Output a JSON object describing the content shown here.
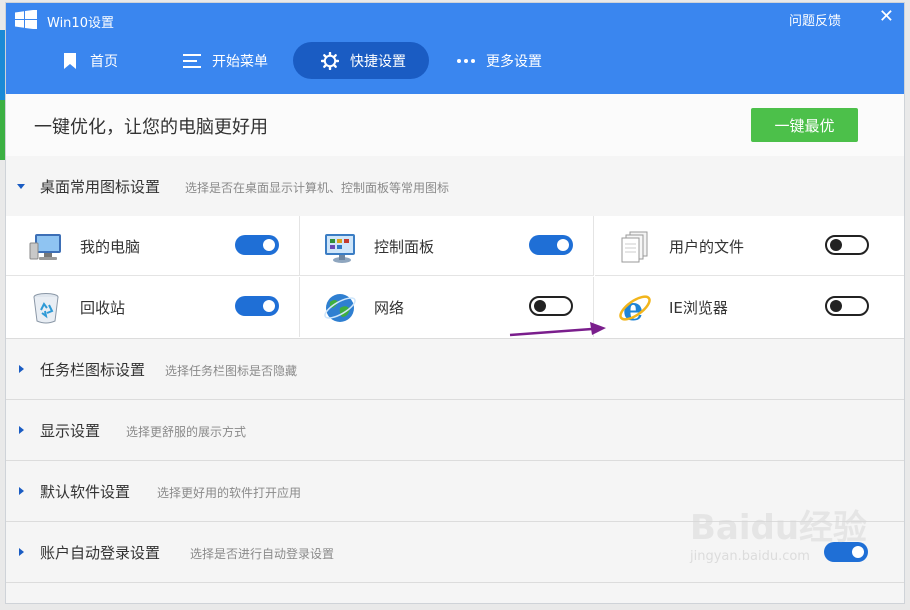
{
  "window": {
    "title": "Win10设置",
    "feedback": "问题反馈",
    "close": "✕"
  },
  "tabs": [
    {
      "label": "首页",
      "icon": "bookmark-icon"
    },
    {
      "label": "开始菜单",
      "icon": "menu-icon"
    },
    {
      "label": "快捷设置",
      "icon": "gear-icon",
      "active": true
    },
    {
      "label": "更多设置",
      "icon": "more-icon"
    }
  ],
  "optimize": {
    "title": "一键优化，让您的电脑更好用",
    "button": "一键最优"
  },
  "sections": {
    "desktop": {
      "title": "桌面常用图标设置",
      "desc": "选择是否在桌面显示计算机、控制面板等常用图标"
    },
    "taskbar": {
      "title": "任务栏图标设置",
      "desc": "选择任务栏图标是否隐藏"
    },
    "display": {
      "title": "显示设置",
      "desc": "选择更舒服的展示方式"
    },
    "software": {
      "title": "默认软件设置",
      "desc": "选择更好用的软件打开应用"
    },
    "autologin": {
      "title": "账户自动登录设置",
      "desc": "选择是否进行自动登录设置"
    }
  },
  "icons": [
    {
      "label": "我的电脑",
      "icon": "computer-icon",
      "on": true
    },
    {
      "label": "控制面板",
      "icon": "control-panel-icon",
      "on": true
    },
    {
      "label": "用户的文件",
      "icon": "documents-icon",
      "on": false
    },
    {
      "label": "回收站",
      "icon": "recycle-bin-icon",
      "on": true
    },
    {
      "label": "网络",
      "icon": "network-icon",
      "on": false
    },
    {
      "label": "IE浏览器",
      "icon": "ie-browser-icon",
      "on": false
    }
  ],
  "watermark": {
    "main": "Baidu经验",
    "sub": "jingyan.baidu.com"
  },
  "colors": {
    "accent": "#3a86ef",
    "active_tab": "#1a5cc3",
    "button_green": "#4cc04a",
    "toggle_on": "#1f6fd6",
    "annotation": "#7a1e8c"
  }
}
